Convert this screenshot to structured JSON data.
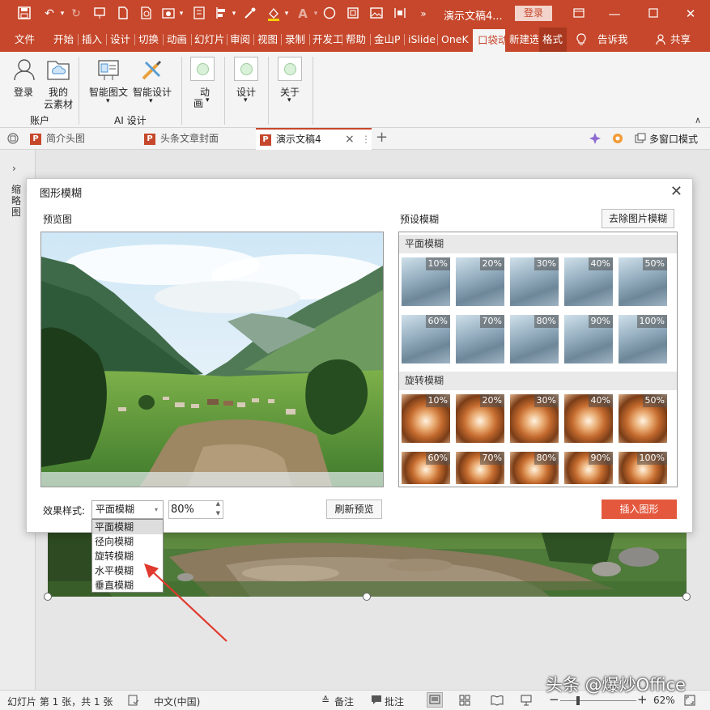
{
  "titlebar": {
    "doc_title": "演示文稿4...",
    "login": "登录",
    "icons": [
      "save-icon",
      "undo-icon",
      "redo-icon",
      "slideshow-icon",
      "new-icon",
      "print-preview-icon",
      "screenshot-icon",
      "format-icon",
      "eyedropper-icon",
      "fill-icon",
      "font-color-icon",
      "shape-icon",
      "crop-icon",
      "picture-icon",
      "align-icon",
      "more-icon"
    ]
  },
  "ribbon_tabs": [
    "文件",
    "开始",
    "插入",
    "设计",
    "切换",
    "动画",
    "幻灯片",
    "审阅",
    "视图",
    "录制",
    "开发工",
    "帮助",
    "金山P",
    "iSlide",
    "OneK",
    "口袋动",
    "新建选",
    "格式",
    "告诉我",
    "共享"
  ],
  "ribbon": {
    "login": "登录",
    "my_material_1": "我的",
    "my_material_2": "云素材",
    "account_group": "账户",
    "smart_image": "智能图文",
    "smart_design": "智能设计",
    "ai_group": "AI 设计",
    "anim_1": "动",
    "anim_2": "画",
    "design": "设计",
    "about": "关于"
  },
  "doc_tabs": {
    "tab1": "简介头图",
    "tab2": "头条文章封面",
    "tab3": "演示文稿4",
    "multiwindow": "多窗口模式"
  },
  "left_pane_label": "缩略图",
  "dialog": {
    "title": "图形模糊",
    "preview_label": "预览图",
    "preset_label": "预设模糊",
    "remove_blur": "去除图片模糊",
    "section_flat": "平面模糊",
    "section_rotate": "旋转模糊",
    "flat_levels": [
      "10%",
      "20%",
      "30%",
      "40%",
      "50%",
      "60%",
      "70%",
      "80%",
      "90%",
      "100%"
    ],
    "rotate_levels": [
      "10%",
      "20%",
      "30%",
      "40%",
      "50%",
      "60%",
      "70%",
      "80%",
      "90%",
      "100%"
    ],
    "effect_label": "效果样式:",
    "effect_value": "平面模糊",
    "percent_value": "80%",
    "refresh": "刷新预览",
    "insert": "插入图形"
  },
  "dropdown_options": [
    "平面模糊",
    "径向模糊",
    "旋转模糊",
    "水平模糊",
    "垂直模糊"
  ],
  "statusbar": {
    "slide_info": "幻灯片 第 1 张，共 1 张",
    "language": "中文(中国)",
    "notes": "备注",
    "comments": "批注",
    "zoom": "62%"
  },
  "watermark": "头条 @爆炒Office",
  "colors": {
    "accent": "#c6472b",
    "insert_button": "#e4593e",
    "arrow": "#e03a2e"
  }
}
